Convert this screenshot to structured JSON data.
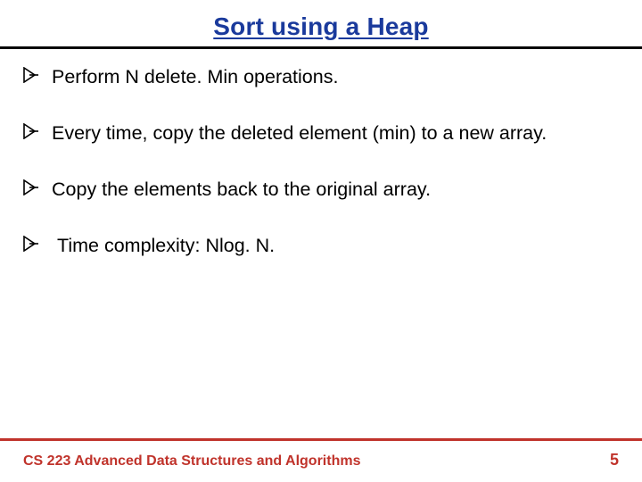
{
  "title": "Sort using a Heap",
  "bullets": [
    "Perform N delete. Min operations.",
    "Every time, copy the deleted element (min) to a new array.",
    "Copy the elements back to the original array.",
    "Time complexity: Nlog. N."
  ],
  "footer": {
    "course": "CS 223 Advanced Data Structures and Algorithms",
    "page": "5"
  },
  "colors": {
    "title": "#1a3a9c",
    "accent": "#c0332b"
  }
}
